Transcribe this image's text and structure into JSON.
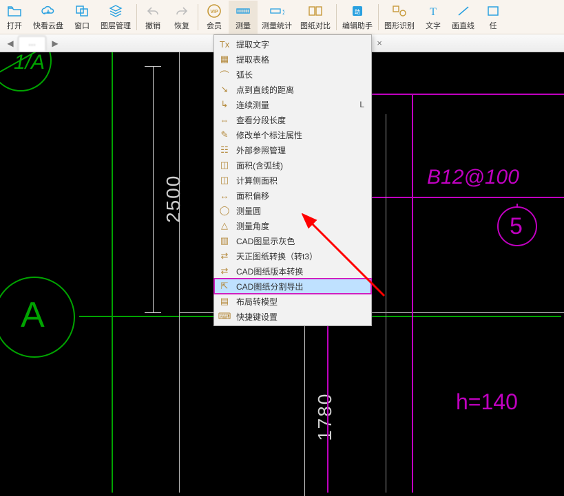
{
  "toolbar": {
    "items": [
      {
        "label": "打开"
      },
      {
        "label": "快看云盘"
      },
      {
        "label": "窗口"
      },
      {
        "label": "图层管理"
      },
      {
        "label": "撤销"
      },
      {
        "label": "恢复"
      },
      {
        "label": "会员"
      },
      {
        "label": "测量"
      },
      {
        "label": "测量统计"
      },
      {
        "label": "图纸对比"
      },
      {
        "label": "编辑助手"
      },
      {
        "label": "图形识别"
      },
      {
        "label": "文字"
      },
      {
        "label": "画直线"
      },
      {
        "label": "任"
      }
    ],
    "active_index": 7
  },
  "tabstrip": {
    "tab_label": "…",
    "close": "×",
    "nav_prev": "◀",
    "nav_next": "▶"
  },
  "dropdown": {
    "items": [
      {
        "icon": "Tx",
        "label": "提取文字",
        "shortcut": ""
      },
      {
        "icon": "▦",
        "label": "提取表格",
        "shortcut": ""
      },
      {
        "icon": "⌒",
        "label": "弧长",
        "shortcut": ""
      },
      {
        "icon": "↘",
        "label": "点到直线的距离",
        "shortcut": ""
      },
      {
        "icon": "↳",
        "label": "连续测量",
        "shortcut": "L"
      },
      {
        "icon": "⇔",
        "label": "查看分段长度",
        "shortcut": ""
      },
      {
        "icon": "✎",
        "label": "修改单个标注属性",
        "shortcut": ""
      },
      {
        "icon": "☷",
        "label": "外部参照管理",
        "shortcut": ""
      },
      {
        "icon": "◫",
        "label": "面积(含弧线)",
        "shortcut": ""
      },
      {
        "icon": "◫",
        "label": "计算侧面积",
        "shortcut": ""
      },
      {
        "icon": "↔",
        "label": "面积偏移",
        "shortcut": ""
      },
      {
        "icon": "◯",
        "label": "测量圆",
        "shortcut": ""
      },
      {
        "icon": "△",
        "label": "测量角度",
        "shortcut": ""
      },
      {
        "icon": "▥",
        "label": "CAD图显示灰色",
        "shortcut": ""
      },
      {
        "icon": "⇄",
        "label": "天正图纸转换（转t3）",
        "shortcut": ""
      },
      {
        "icon": "⇄",
        "label": "CAD图纸版本转换",
        "shortcut": ""
      },
      {
        "icon": "⇱",
        "label": "CAD图纸分割导出",
        "shortcut": ""
      },
      {
        "icon": "▤",
        "label": "布局转模型",
        "shortcut": ""
      },
      {
        "icon": "⌨",
        "label": "快捷键设置",
        "shortcut": ""
      }
    ],
    "highlight_index": 16
  },
  "drawing": {
    "bubble1_text": "1/A",
    "bubble2_text": "A",
    "bubble3_text": "5",
    "dim1": "2500",
    "dim2": "1780",
    "rebar_text": "B12@100",
    "h_text": "h=140"
  }
}
